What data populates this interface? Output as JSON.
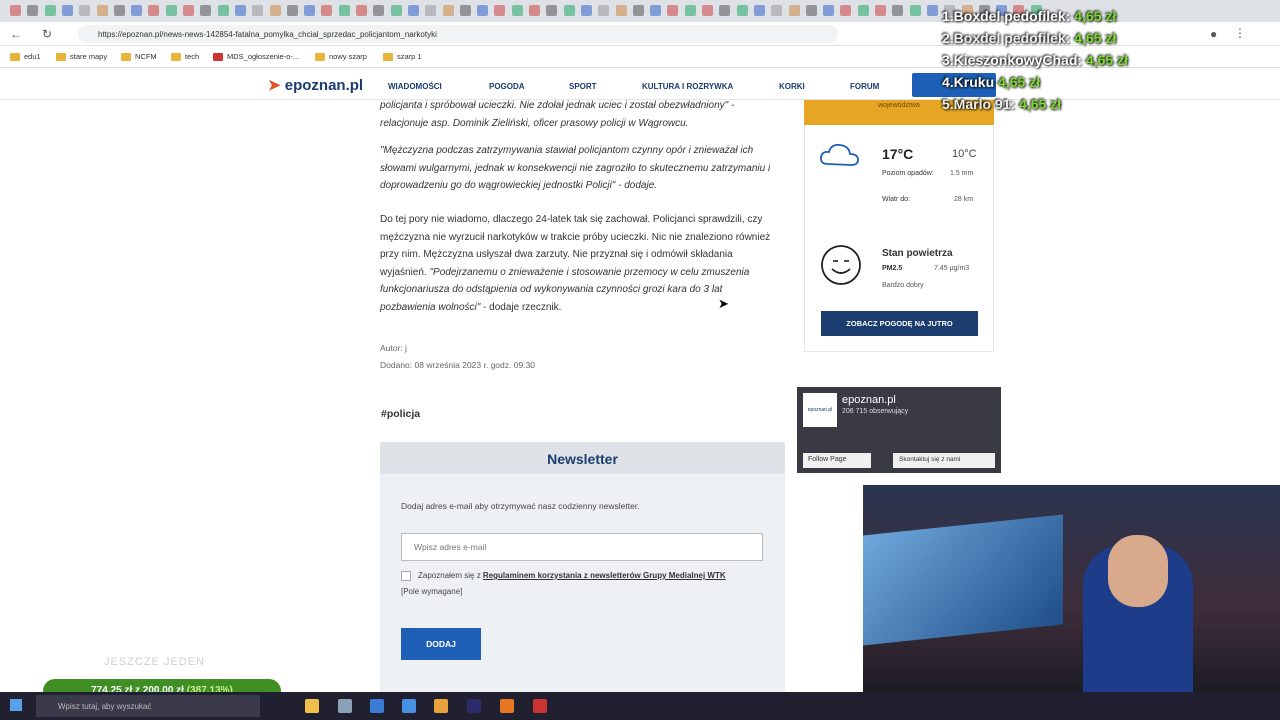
{
  "browser": {
    "url": "https://epoznan.pl/news-news-142854-fatalna_pomylka_chcial_sprzedac_policjantom_narkotyki",
    "bookmarks": [
      "edu1",
      "stare mapy",
      "NCFM",
      "tech",
      "MDS_ogłoszenie-o-...",
      "nowy szarp",
      "szarp 1"
    ]
  },
  "site": {
    "logo": "epoznan.pl",
    "nav": [
      "WIADOMOŚCI",
      "POGODA",
      "SPORT",
      "KULTURA I ROZRYWKA",
      "KORKI",
      "FORUM"
    ]
  },
  "article": {
    "p1": "policjanta i spróbował ucieczki. Nie zdołał jednak uciec i został obezwładniony\" - relacjonuje asp. Dominik Zieliński, oficer prasowy policji w Wągrowcu.",
    "p2": "\"Mężczyzna podczas zatrzymywania stawiał policjantom czynny opór i znieważał ich słowami wulgarnymi, jednak w konsekwencji nie zagroziło to skutecznemu zatrzymaniu i doprowadzeniu go do wągrowieckiej jednostki Policji\" - dodaje.",
    "p3a": "Do tej pory nie wiadomo, dlaczego 24-latek tak się zachował. Policjanci sprawdzili, czy mężczyzna nie wyrzucił narkotyków w trakcie próby ucieczki. Nic nie znaleziono również przy nim. Mężczyzna usłyszał dwa zarzuty. Nie przyznał się i odmówił składania wyjaśnień.",
    "p3b": "\"Podejrzanemu o znieważenie i stosowanie przemocy w celu zmuszenia funkcjonariusza do odstąpienia od wykonywania czynności grozi kara do 3 lat pozbawienia wolności\"",
    "p3c": " - dodaje rzecznik.",
    "author": "Autor: j",
    "added": "Dodano: 08 września 2023 r. godz. 09:30",
    "tag": "#policja"
  },
  "newsletter": {
    "title": "Newsletter",
    "desc": "Dodaj adres e-mail aby otrzymywać nasz codzienny newsletter.",
    "placeholder": "Wpisz adres e-mail",
    "consent_prefix": "Zapoznałem się z ",
    "consent_link": "Regulaminem korzystania z newsletterów Grupy Medialnej WTK",
    "required": "[Pole wymagane]",
    "button": "DODAJ"
  },
  "weather": {
    "header": "województwa",
    "temp_high": "17°C",
    "temp_low": "10°C",
    "precip_label": "Poziom opadów:",
    "precip_value": "1.5 mm",
    "wind_label": "Wiatr do:",
    "wind_value": "28 km",
    "air_title": "Stan powietrza",
    "pm_label": "PM2.5",
    "pm_value": "7.45 µg/m3",
    "air_quality": "Bardzo dobry",
    "button": "ZOBACZ POGODĘ NA JUTRO"
  },
  "facebook": {
    "name": "epoznan.pl",
    "followers": "206 715 obserwujący",
    "follow": "Follow Page",
    "contact": "Skontaktuj się z nami"
  },
  "overlay": {
    "ranking": [
      {
        "name": "1.Boxdel pedofilek:",
        "amount": "4,65 zł"
      },
      {
        "name": "2.Boxdel pedofilek:",
        "amount": "4,65 zł"
      },
      {
        "name": "3.KieszonkowyChad:",
        "amount": "4,65 zł"
      },
      {
        "name": "4.Kruku",
        "amount": "4,65 zł"
      },
      {
        "name": "5.Marlo 91:",
        "amount": "4,65 zł"
      }
    ],
    "goal_text": "774,25 zł z 200,00 zł",
    "goal_percent": "(387.13%)",
    "goal_fraction": 1.0,
    "label": "JESZCZE JEDEN"
  },
  "taskbar": {
    "search_placeholder": "Wpisz tutaj, aby wyszukać"
  },
  "colors": {
    "brand_blue": "#1a3c6e",
    "button_blue": "#1d5fb6",
    "weather_yellow": "#e6a623",
    "overlay_green": "#3f8f25"
  }
}
